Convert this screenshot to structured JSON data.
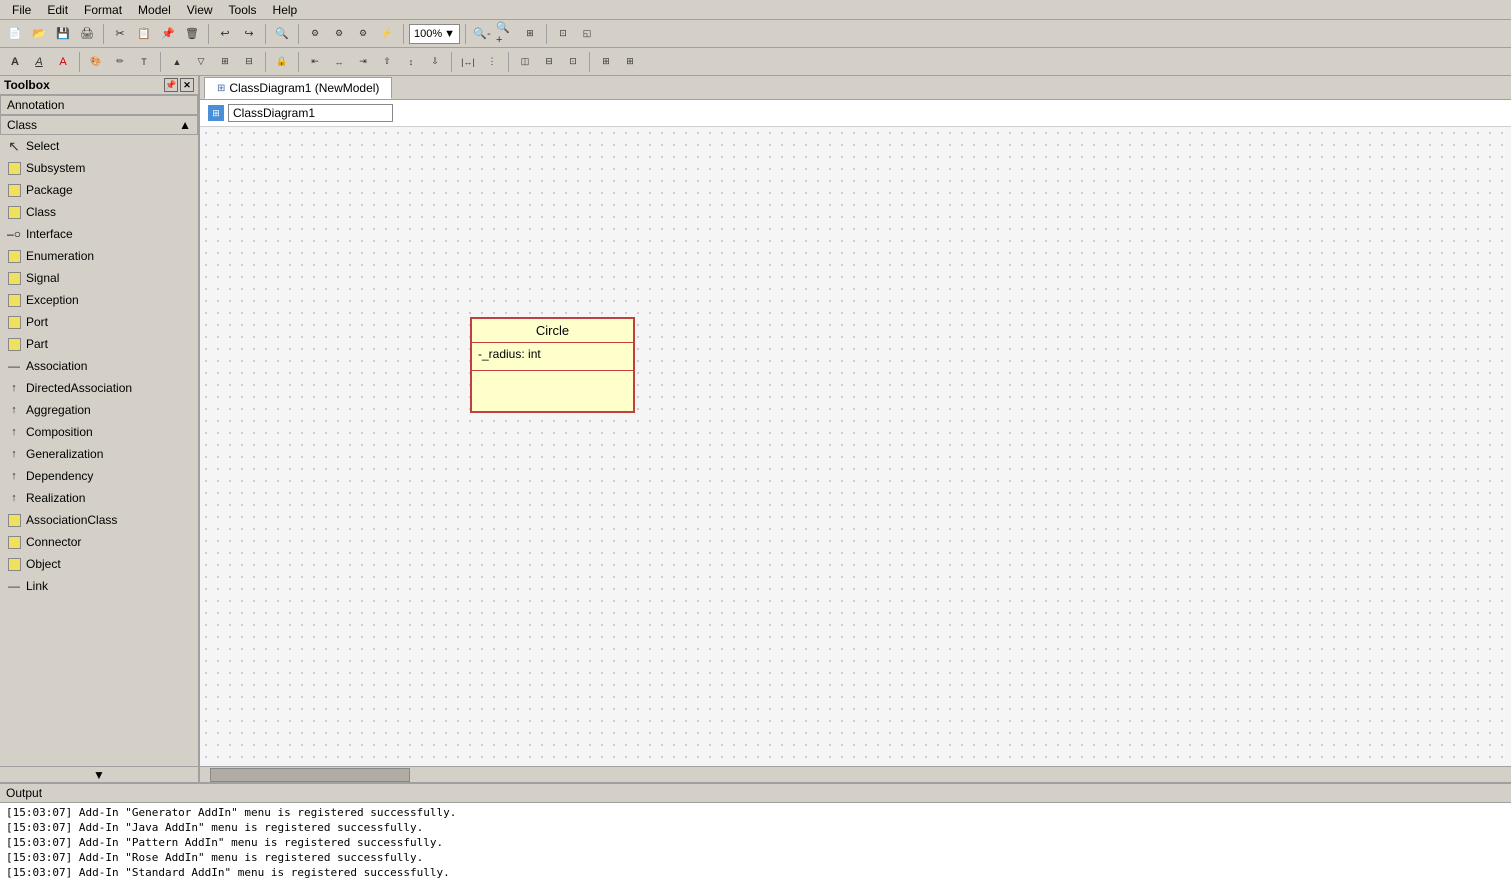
{
  "menubar": {
    "items": [
      "File",
      "Edit",
      "Format",
      "Model",
      "View",
      "Tools",
      "Help"
    ]
  },
  "toolbar1": {
    "zoom_value": "100%",
    "buttons": [
      "new",
      "open",
      "save",
      "print",
      "cut",
      "copy",
      "paste",
      "delete",
      "undo",
      "redo",
      "find",
      "generate",
      "check",
      "zoom-in",
      "zoom-out",
      "fit",
      "select-all"
    ]
  },
  "toolbar2": {
    "buttons": [
      "bold",
      "italic",
      "underline",
      "color",
      "left",
      "center",
      "right",
      "layer",
      "group",
      "ungroup",
      "lock",
      "align-left",
      "align-center",
      "align-right",
      "distribute",
      "spacing",
      "grid",
      "snap"
    ]
  },
  "toolbox": {
    "title": "Toolbox",
    "pin_label": "📌",
    "close_label": "✕",
    "annotation_section": "Annotation",
    "class_section": "Class",
    "items": [
      {
        "label": "Select",
        "icon": "select"
      },
      {
        "label": "Subsystem",
        "icon": "box"
      },
      {
        "label": "Package",
        "icon": "box"
      },
      {
        "label": "Class",
        "icon": "box"
      },
      {
        "label": "Interface",
        "icon": "circle-dash"
      },
      {
        "label": "Enumeration",
        "icon": "box"
      },
      {
        "label": "Signal",
        "icon": "box"
      },
      {
        "label": "Exception",
        "icon": "box"
      },
      {
        "label": "Port",
        "icon": "box"
      },
      {
        "label": "Part",
        "icon": "box"
      },
      {
        "label": "Association",
        "icon": "line"
      },
      {
        "label": "DirectedAssociation",
        "icon": "arrow"
      },
      {
        "label": "Aggregation",
        "icon": "arrow"
      },
      {
        "label": "Composition",
        "icon": "arrow"
      },
      {
        "label": "Generalization",
        "icon": "arrow"
      },
      {
        "label": "Dependency",
        "icon": "arrow"
      },
      {
        "label": "Realization",
        "icon": "arrow"
      },
      {
        "label": "AssociationClass",
        "icon": "box"
      },
      {
        "label": "Connector",
        "icon": "box"
      },
      {
        "label": "Object",
        "icon": "box"
      },
      {
        "label": "Link",
        "icon": "line"
      }
    ],
    "scroll_down_label": "▼"
  },
  "diagram": {
    "tab_label": "ClassDiagram1 (NewModel)",
    "name": "ClassDiagram1",
    "name_cursor": "|"
  },
  "uml_class": {
    "title": "Circle",
    "attributes": [
      "-_radius: int"
    ],
    "methods": []
  },
  "output": {
    "title": "Output",
    "lines": [
      "[15:03:07]  Add-In \"Generator AddIn\" menu is registered successfully.",
      "[15:03:07]  Add-In \"Java AddIn\" menu is registered successfully.",
      "[15:03:07]  Add-In \"Pattern AddIn\" menu is registered successfully.",
      "[15:03:07]  Add-In \"Rose AddIn\" menu is registered successfully.",
      "[15:03:07]  Add-In \"Standard AddIn\" menu is registered successfully."
    ]
  }
}
